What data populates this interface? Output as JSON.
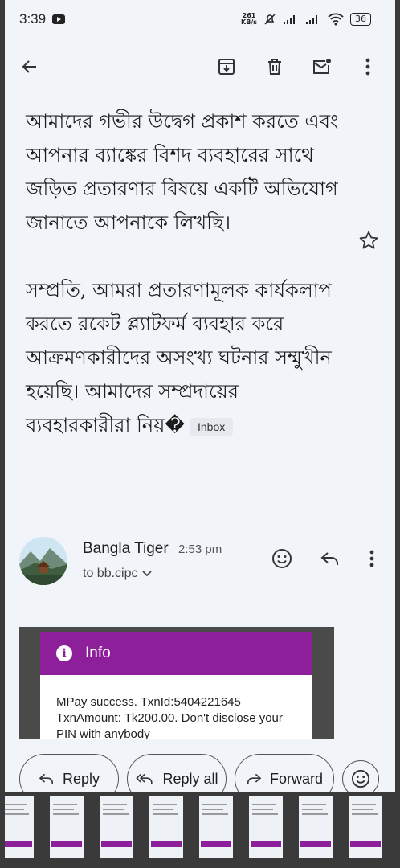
{
  "status_bar": {
    "time": "3:39",
    "net_speed": "261",
    "net_unit": "KB/s",
    "battery": "36"
  },
  "toolbar": {
    "back": "back-arrow-icon",
    "archive": "archive-icon",
    "delete": "trash-icon",
    "mark_unread": "mail-unread-icon",
    "more": "more-vert-icon"
  },
  "email": {
    "paragraphs": [
      "আমাদের গভীর উদ্বেগ প্রকাশ করতে এবং আপনার ব্যাঙ্কের বিশদ ব্যবহারের সাথে জড়িত প্রতারণার বিষয়ে একটি অভিযোগ জানাতে আপনাকে লিখছি।",
      "সম্প্রতি, আমরা প্রতারণামূলক কার্যকলাপ করতে রকেট প্ল্যাটফর্ম ব্যবহার করে আক্রমণকারীদের অসংখ্য ঘটনার সম্মুখীন হয়েছি। আমাদের সম্প্রদায়ের ব্যবহারকারীরা নিয়�"
    ],
    "label_chip": "Inbox"
  },
  "sender": {
    "name": "Bangla Tiger",
    "time": "2:53 pm",
    "to": "to bb.cipc"
  },
  "attachment": {
    "header": "Info",
    "message": "MPay success. TxnId:5404221645 TxnAmount: Tk200.00. Don't disclose your PIN with anybody"
  },
  "actions": {
    "reply": "Reply",
    "reply_all": "Reply all",
    "forward": "Forward"
  },
  "colors": {
    "background": "#f1f5fa",
    "attachment_header": "#8e1f9b"
  }
}
